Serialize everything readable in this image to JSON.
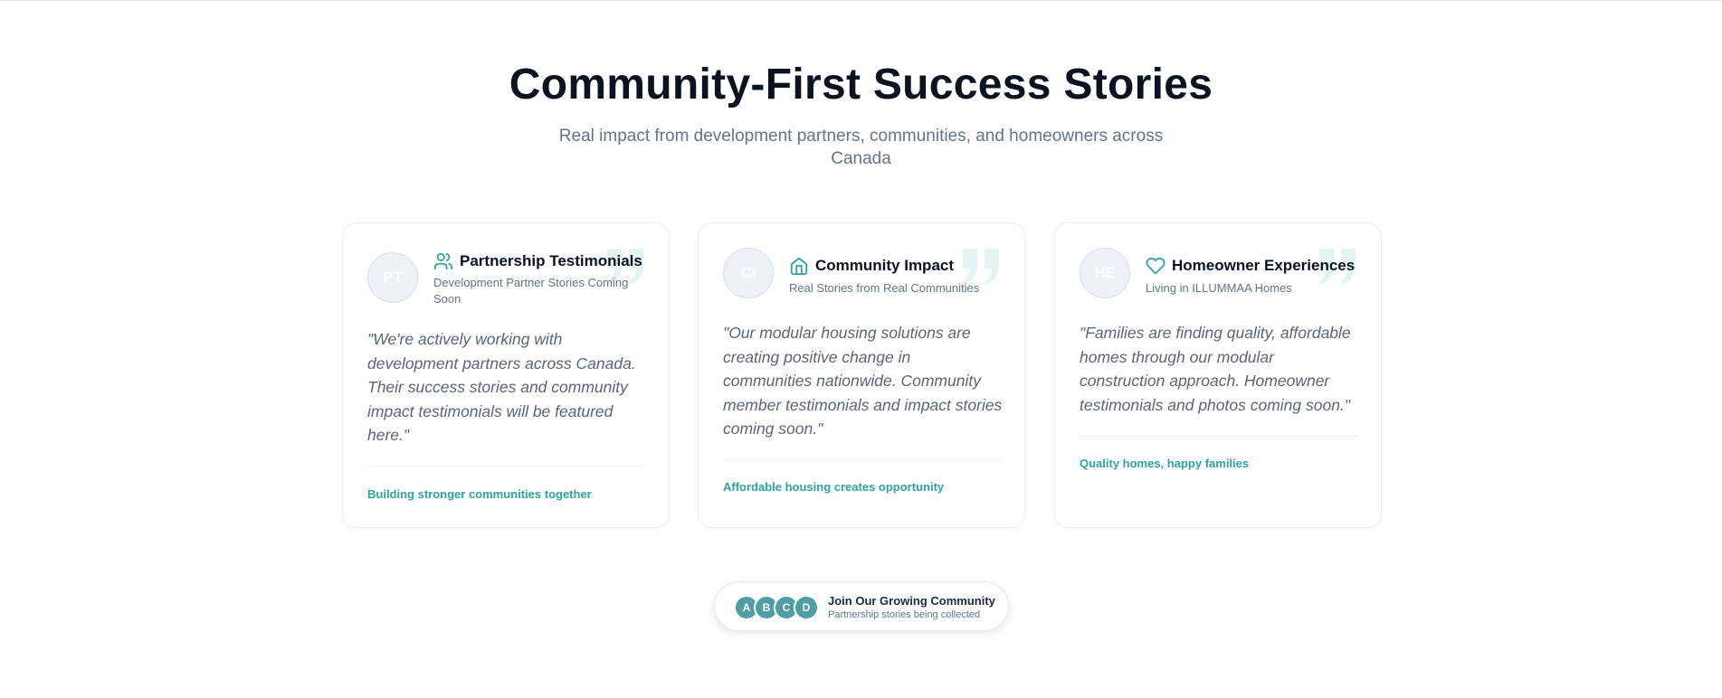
{
  "section": {
    "heading": "Community-First Success Stories",
    "subheading": "Real impact from development partners, communities, and homeowners across Canada"
  },
  "cards": [
    {
      "initials": "PT",
      "icon": "users-icon",
      "title": "Partnership Testimonials",
      "subtitle": "Development Partner Stories Coming Soon",
      "quote": "\"We're actively working with development partners across Canada. Their success stories and community impact testimonials will be featured here.\"",
      "tagline": "Building stronger communities together"
    },
    {
      "initials": "CI",
      "icon": "home-icon",
      "title": "Community Impact",
      "subtitle": "Real Stories from Real Communities",
      "quote": "\"Our modular housing solutions are creating positive change in communities nationwide. Community member testimonials and impact stories coming soon.\"",
      "tagline": "Affordable housing creates opportunity"
    },
    {
      "initials": "HE",
      "icon": "heart-icon",
      "title": "Homeowner Experiences",
      "subtitle": "Living in ILLUMMAA Homes",
      "quote": "\"Families are finding quality, affordable homes through our modular construction approach. Homeowner testimonials and photos coming soon.\"",
      "tagline": "Quality homes, happy families"
    }
  ],
  "community_pill": {
    "avatars": [
      "A",
      "B",
      "C",
      "D"
    ],
    "title": "Join Our Growing Community",
    "subtitle": "Partnership stories being collected"
  },
  "colors": {
    "accent": "#2ea3a0",
    "avatar_bg": "#4f9ea3",
    "quote_mark": "#e3f5f3",
    "heading": "#0b1220",
    "muted": "#64748b"
  }
}
